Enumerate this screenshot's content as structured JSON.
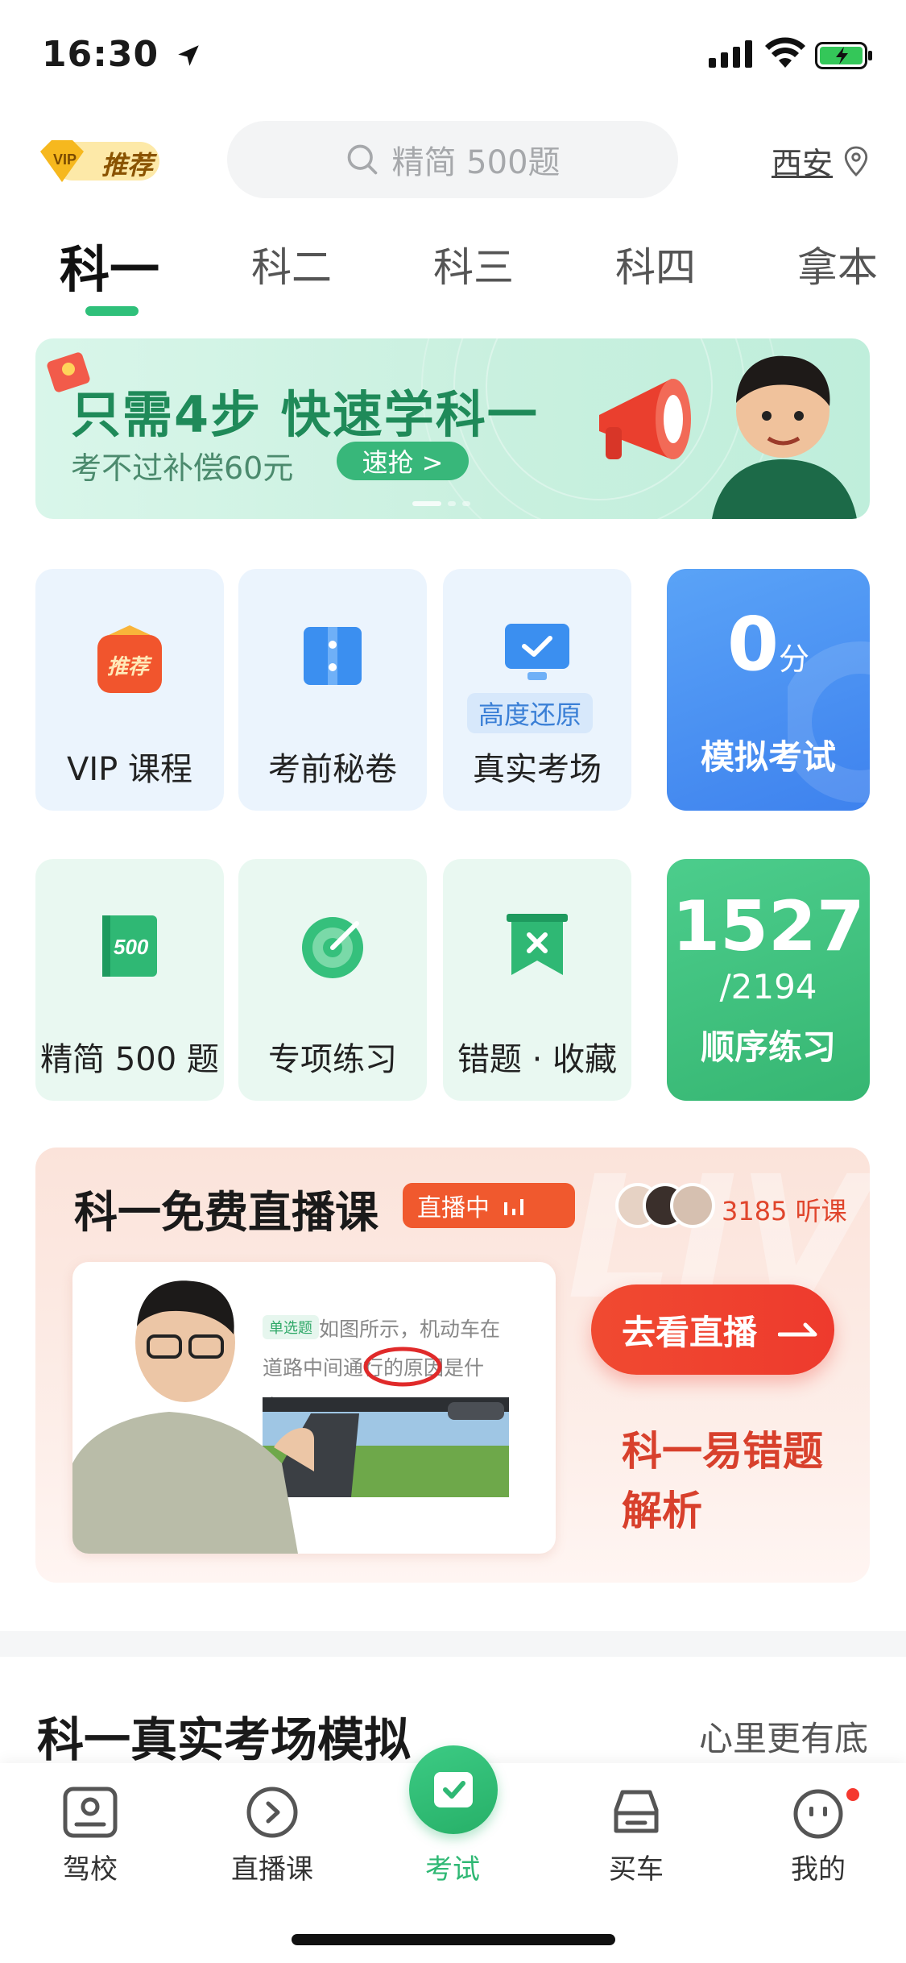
{
  "status_bar": {
    "time": "16:30"
  },
  "header": {
    "vip_badge": "推荐",
    "search_placeholder": "精简 500题",
    "city": "西安"
  },
  "tabs": [
    {
      "label": "科一",
      "active": true
    },
    {
      "label": "科二"
    },
    {
      "label": "科三"
    },
    {
      "label": "科四"
    },
    {
      "label": "拿本"
    }
  ],
  "banner": {
    "title": "只需4步 快速学科一",
    "subtitle": "考不过补偿60元",
    "button": "速抢 >"
  },
  "tiles_row1": [
    {
      "label": "VIP 课程",
      "icon": "vip-recommend-icon"
    },
    {
      "label": "考前秘卷",
      "icon": "secret-paper-icon"
    },
    {
      "label": "真实考场",
      "tag": "高度还原",
      "icon": "monitor-check-icon"
    }
  ],
  "mock_exam": {
    "score": "0",
    "unit": "分",
    "label": "模拟考试"
  },
  "tiles_row2": [
    {
      "label": "精简 500 题",
      "icon": "book-500-icon",
      "icon_text": "500"
    },
    {
      "label": "专项练习",
      "icon": "target-icon"
    },
    {
      "label": "错题 · 收藏",
      "icon": "bookmark-x-icon"
    }
  ],
  "sequence": {
    "done": "1527",
    "total": "/2194",
    "label": "顺序练习"
  },
  "live": {
    "title": "科一免费直播课",
    "badge": "直播中",
    "listeners": "3185 听课",
    "question_tag": "单选题",
    "question": "如图所示，机动车在道路中间通行的原因是什么?",
    "watch_button": "去看直播",
    "topic": "科一易错题解析"
  },
  "section": {
    "title": "科一真实考场模拟",
    "subtitle": "心里更有底"
  },
  "bottom_nav": [
    {
      "label": "驾校",
      "icon": "driving-school-icon"
    },
    {
      "label": "直播课",
      "icon": "live-play-icon"
    },
    {
      "label": "考试",
      "icon": "exam-check-icon",
      "active": true
    },
    {
      "label": "买车",
      "icon": "car-icon"
    },
    {
      "label": "我的",
      "icon": "profile-face-icon"
    }
  ],
  "colors": {
    "brand_green": "#2fc07a",
    "live_red": "#ee3a2d",
    "mock_blue": "#3e82ee"
  }
}
